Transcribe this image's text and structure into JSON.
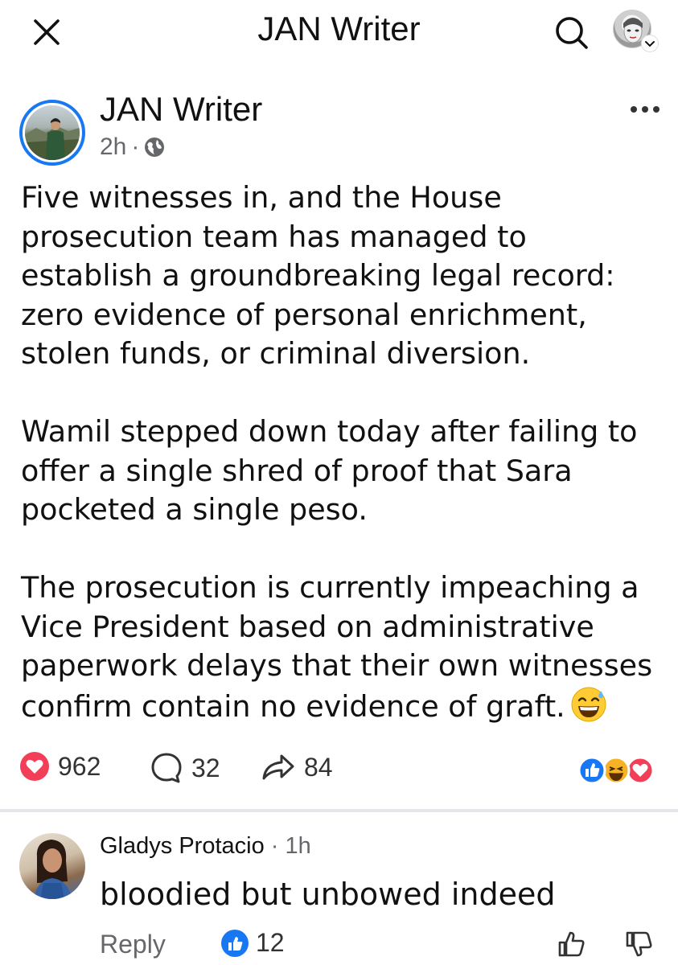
{
  "header": {
    "title": "JAN Writer",
    "close_icon": "close-icon",
    "search_icon": "search-icon",
    "profile_icon": "profile-avatar"
  },
  "post": {
    "author": "JAN Writer",
    "time": "2h",
    "separator": "·",
    "audience_icon": "globe-icon",
    "paragraphs": [
      "Five witnesses in, and the House prosecution team has managed to establish a groundbreaking legal record: zero evidence of personal enrichment, stolen funds, or criminal diversion.",
      "Wamil stepped down today after failing to offer a single shred of proof that Sara pocketed a single peso.",
      "The prosecution is currently impeaching a Vice President based on administrative paperwork delays that their own witnesses confirm contain no evidence of graft."
    ],
    "emoji": "grinning-sweat-emoji"
  },
  "stats": {
    "reactions": "962",
    "comments": "32",
    "shares": "84",
    "reaction_icons": [
      "like-icon",
      "haha-icon",
      "love-icon"
    ]
  },
  "comment": {
    "name": "Gladys Protacio",
    "separator": "·",
    "time": "1h",
    "text": "bloodied but unbowed indeed",
    "reply_label": "Reply",
    "like_count": "12"
  },
  "colors": {
    "brand_blue": "#1877f2",
    "love_red": "#f33e58",
    "haha_yellow": "#f7b125",
    "secondary_text": "#65676b"
  }
}
